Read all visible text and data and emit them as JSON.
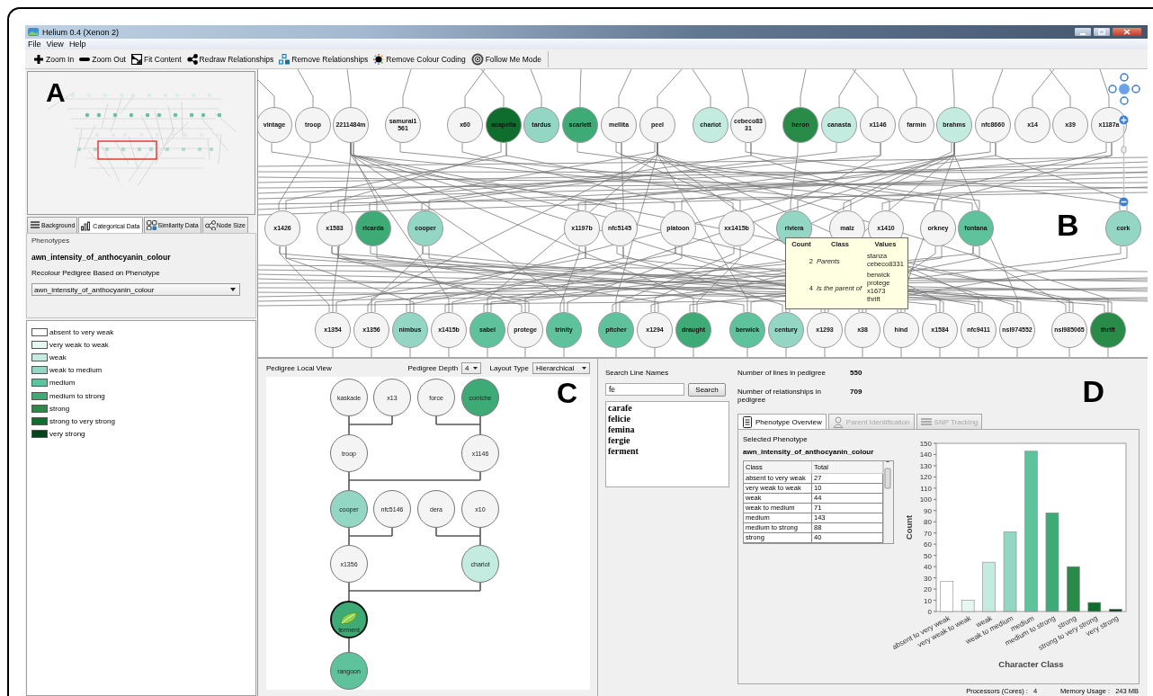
{
  "window": {
    "title": "Helium 0.4 (Xenon 2)"
  },
  "menu": [
    "File",
    "View",
    "Help"
  ],
  "toolbar": [
    {
      "kind": "zoom-in",
      "label": "Zoom In"
    },
    {
      "kind": "zoom-out",
      "label": "Zoom Out"
    },
    {
      "kind": "fit",
      "label": "Fit Content"
    },
    {
      "kind": "redraw",
      "label": "Redraw Relationships"
    },
    {
      "kind": "remove-relationships",
      "label": "Remove Relationships"
    },
    {
      "kind": "remove-colour",
      "label": "Remove Colour Coding"
    },
    {
      "kind": "follow",
      "label": "Follow Me Mode"
    }
  ],
  "overview": {
    "annotation": "A"
  },
  "side_tabs": [
    {
      "kind": "background",
      "label": "Background",
      "selected": false
    },
    {
      "kind": "categorical",
      "label": "Categorical Data",
      "selected": true
    },
    {
      "kind": "similarity",
      "label": "Similarity Data",
      "selected": false
    },
    {
      "kind": "node-size",
      "label": "Node Size",
      "selected": false
    }
  ],
  "phenotypes": {
    "group_title": "Phenotypes",
    "selected_phenotype": "awn_intensity_of_anthocyanin_colour",
    "recolour_label": "Recolour Pedigree Based on Phenotype",
    "dropdown_value": "awn_intensity_of_anthocyanin_colour"
  },
  "legend": [
    {
      "label": "absent to very weak",
      "color": "#ffffff"
    },
    {
      "label": "very weak to weak",
      "color": "#e6f6f2"
    },
    {
      "label": "weak",
      "color": "#c4ebe0"
    },
    {
      "label": "weak to medium",
      "color": "#92d6c3"
    },
    {
      "label": "medium",
      "color": "#5ec29d"
    },
    {
      "label": "medium to strong",
      "color": "#3eab77"
    },
    {
      "label": "strong",
      "color": "#288c48"
    },
    {
      "label": "strong to very strong",
      "color": "#0f6e2e"
    },
    {
      "label": "very strong",
      "color": "#02441a"
    }
  ],
  "pedigree_view": {
    "annotation": "B",
    "rows": [
      {
        "nodes": [
          {
            "label": "vintage",
            "color": "#f4f4f4"
          },
          {
            "label": "troop",
            "color": "#f4f4f4"
          },
          {
            "label": "2211484m",
            "color": "#f4f4f4"
          },
          {
            "label": "samurai1561",
            "color": "#f4f4f4"
          },
          {
            "label": "x60",
            "color": "#f4f4f4"
          },
          {
            "label": "acapella",
            "color": "#0f6e2e"
          },
          {
            "label": "tardus",
            "color": "#92d6c3"
          },
          {
            "label": "scarlett",
            "color": "#3eab77"
          },
          {
            "label": "mellita",
            "color": "#f4f4f4"
          },
          {
            "label": "peel",
            "color": "#f4f4f4"
          },
          {
            "label": "chariot",
            "color": "#c4ebe0"
          },
          {
            "label": "cebeco8331",
            "color": "#f4f4f4"
          },
          {
            "label": "heron",
            "color": "#288c48"
          },
          {
            "label": "canasta",
            "color": "#c4ebe0"
          },
          {
            "label": "x1146",
            "color": "#f4f4f4"
          },
          {
            "label": "farmin",
            "color": "#f4f4f4"
          },
          {
            "label": "brahms",
            "color": "#c4ebe0"
          },
          {
            "label": "nfc8660",
            "color": "#f4f4f4"
          },
          {
            "label": "x14",
            "color": "#f4f4f4"
          },
          {
            "label": "x39",
            "color": "#f4f4f4"
          },
          {
            "label": "x1187a",
            "color": "#f4f4f4"
          }
        ]
      },
      {
        "nodes": [
          {
            "label": "x1426",
            "color": "#f4f4f4"
          },
          {
            "label": "x1583",
            "color": "#f4f4f4"
          },
          {
            "label": "ricarda",
            "color": "#3eab77"
          },
          {
            "label": "cooper",
            "color": "#92d6c3"
          },
          {
            "label": "x1197b",
            "color": "#f4f4f4"
          },
          {
            "label": "nfc5145",
            "color": "#f4f4f4"
          },
          {
            "label": "platoon",
            "color": "#f4f4f4"
          },
          {
            "label": "xx1415b",
            "color": "#f4f4f4"
          },
          {
            "label": "riviera",
            "color": "#92d6c3"
          },
          {
            "label": "malz",
            "color": "#f4f4f4"
          },
          {
            "label": "x1410",
            "color": "#f4f4f4"
          },
          {
            "label": "orkney",
            "color": "#f4f4f4"
          },
          {
            "label": "fontana",
            "color": "#5ec29d"
          },
          {
            "label": "cork",
            "color": "#92d6c3"
          }
        ]
      },
      {
        "nodes": [
          {
            "label": "x1354",
            "color": "#f4f4f4"
          },
          {
            "label": "x1356",
            "color": "#f4f4f4"
          },
          {
            "label": "nimbus",
            "color": "#92d6c3"
          },
          {
            "label": "x1415b",
            "color": "#f4f4f4"
          },
          {
            "label": "sabel",
            "color": "#5ec29d"
          },
          {
            "label": "protege",
            "color": "#f4f4f4"
          },
          {
            "label": "trinity",
            "color": "#5ec29d"
          },
          {
            "label": "pitcher",
            "color": "#5ec29d"
          },
          {
            "label": "x1294",
            "color": "#f4f4f4"
          },
          {
            "label": "draught",
            "color": "#3eab77"
          },
          {
            "label": "berwick",
            "color": "#5ec29d"
          },
          {
            "label": "century",
            "color": "#92d6c3"
          },
          {
            "label": "x1293",
            "color": "#f4f4f4"
          },
          {
            "label": "x38",
            "color": "#f4f4f4"
          },
          {
            "label": "hind",
            "color": "#f4f4f4"
          },
          {
            "label": "x1584",
            "color": "#f4f4f4"
          },
          {
            "label": "nfc9411",
            "color": "#f4f4f4"
          },
          {
            "label": "nsl974552",
            "color": "#f4f4f4"
          },
          {
            "label": "nsl985065",
            "color": "#f4f4f4"
          },
          {
            "label": "thrift",
            "color": "#288c48"
          }
        ]
      }
    ],
    "tooltip": {
      "headers": [
        "Count",
        "Class",
        "Values"
      ],
      "rows": [
        {
          "count": "2",
          "class": "Parents",
          "values": [
            "stanza",
            "cebeco8331"
          ]
        },
        {
          "count": "4",
          "class": "Is the parent of",
          "values": [
            "berwick",
            "protege",
            "x1673",
            "thrift"
          ]
        }
      ]
    }
  },
  "local_view": {
    "title": "Pedigree Local View",
    "depth_label": "Pedigree Depth",
    "depth_value": "4",
    "layout_label": "Layout Type",
    "layout_value": "Hierarchical",
    "annotation": "C",
    "nodes": [
      {
        "label": "kaskade",
        "color": "#f4f4f4",
        "selected": false
      },
      {
        "label": "x13",
        "color": "#f4f4f4",
        "selected": false
      },
      {
        "label": "force",
        "color": "#f4f4f4",
        "selected": false
      },
      {
        "label": "corriche",
        "color": "#3eab77",
        "selected": false
      },
      {
        "label": "troop",
        "color": "#f4f4f4",
        "selected": false
      },
      {
        "label": "x1146",
        "color": "#f4f4f4",
        "selected": false
      },
      {
        "label": "cooper",
        "color": "#92d6c3",
        "selected": false
      },
      {
        "label": "nfc5146",
        "color": "#f4f4f4",
        "selected": false
      },
      {
        "label": "dera",
        "color": "#f4f4f4",
        "selected": false
      },
      {
        "label": "x10",
        "color": "#f4f4f4",
        "selected": false
      },
      {
        "label": "x1356",
        "color": "#f4f4f4",
        "selected": false
      },
      {
        "label": "chariot",
        "color": "#c4ebe0",
        "selected": false
      },
      {
        "label": "ferment",
        "color": "#3eab77",
        "selected": true
      },
      {
        "label": "rangoon",
        "color": "#5ec29d",
        "selected": false
      }
    ]
  },
  "search": {
    "label": "Search Line Names",
    "value": "fe",
    "button": "Search",
    "results": [
      "carafe",
      "felicie",
      "femina",
      "fergie",
      "ferment"
    ]
  },
  "stats": [
    {
      "label": "Number of lines in pedigree",
      "value": "550"
    },
    {
      "label": "Number of relationships in pedigree",
      "value": "709"
    }
  ],
  "details_annotation": "D",
  "detail_tabs": [
    {
      "kind": "overview",
      "label": "Phenotype Overview",
      "selected": true,
      "disabled": false
    },
    {
      "kind": "parent",
      "label": "Parent Identification",
      "selected": false,
      "disabled": true
    },
    {
      "kind": "snp",
      "label": "SNP Tracking",
      "selected": false,
      "disabled": true
    }
  ],
  "phenotype_overview": {
    "selected_label": "Selected Phenotype",
    "selected_value": "awn_intensity_of_anthocyanin_colour",
    "table": {
      "columns": [
        "Class",
        "Total"
      ],
      "rows": [
        [
          "absent to very weak",
          "27"
        ],
        [
          "very weak to weak",
          "10"
        ],
        [
          "weak",
          "44"
        ],
        [
          "weak to medium",
          "71"
        ],
        [
          "medium",
          "143"
        ],
        [
          "medium to strong",
          "88"
        ],
        [
          "strong",
          "40"
        ]
      ]
    },
    "chart_data": {
      "type": "bar",
      "xlabel": "Character Class",
      "ylabel": "Count",
      "categories": [
        "absent to very weak",
        "very weak to weak",
        "weak",
        "weak to medium",
        "medium",
        "medium to strong",
        "strong",
        "strong to very strong",
        "very strong"
      ],
      "series": [
        {
          "values": [
            27,
            10,
            44,
            71,
            143,
            88,
            40,
            8,
            2
          ]
        }
      ],
      "ylim": [
        0,
        150
      ],
      "yticks": [
        0,
        10,
        20,
        30,
        40,
        50,
        60,
        70,
        80,
        90,
        100,
        110,
        120,
        130,
        140,
        150
      ]
    }
  },
  "status_bar": [
    {
      "label": "Processors (Cores) :",
      "value": "4"
    },
    {
      "label": "Memory Usage :",
      "value": "243 MB"
    }
  ]
}
